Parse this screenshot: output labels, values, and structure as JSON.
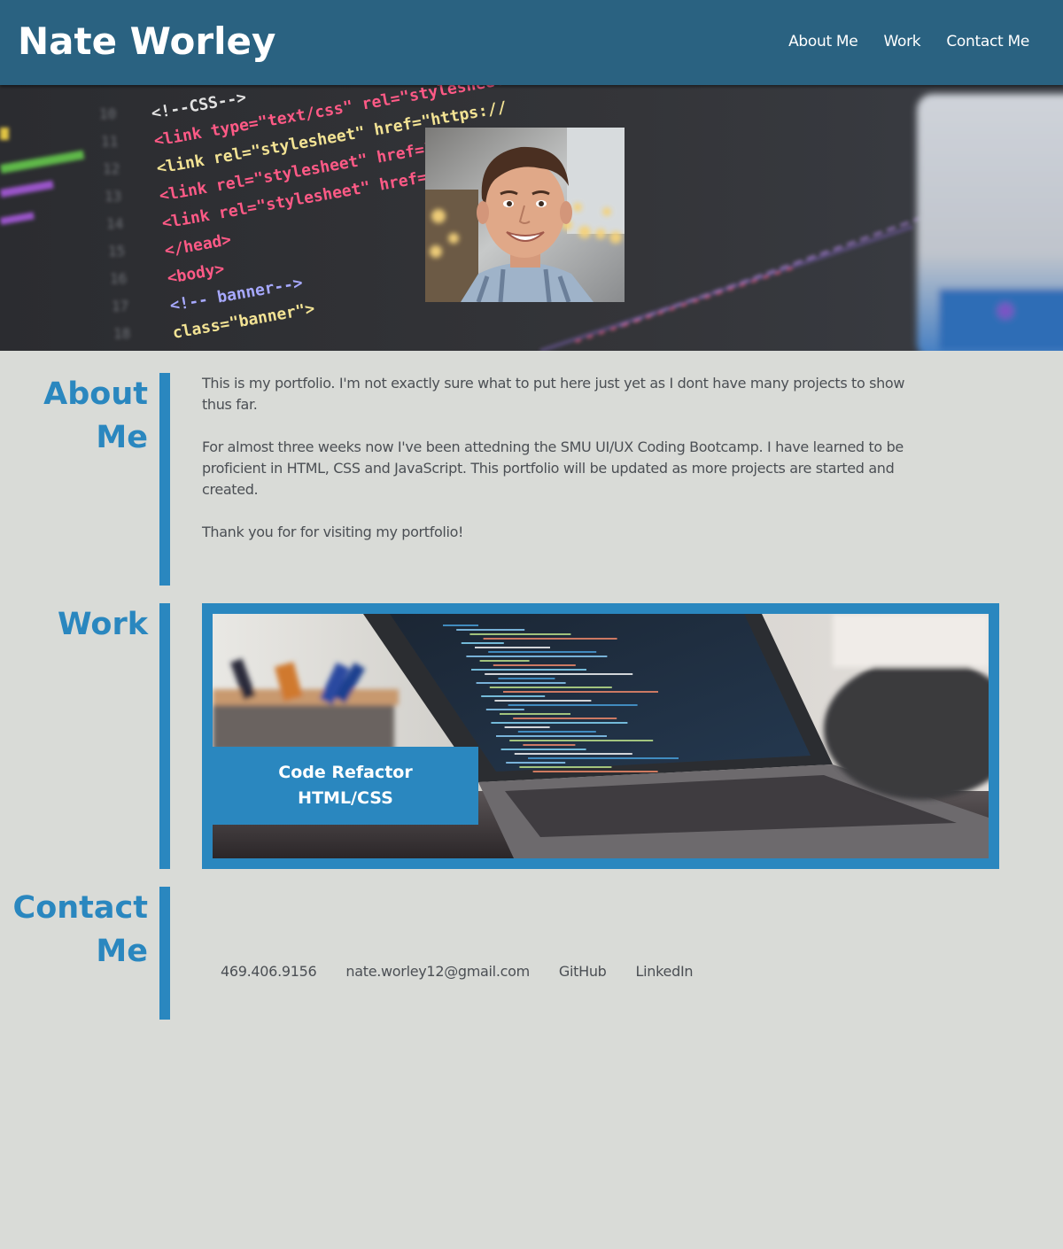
{
  "header": {
    "title": "Nate Worley",
    "nav": [
      {
        "label": "About Me"
      },
      {
        "label": "Work"
      },
      {
        "label": "Contact Me"
      }
    ]
  },
  "hero": {
    "code_lines": [
      {
        "num": "10",
        "text": "<!--CSS-->"
      },
      {
        "num": "11",
        "text": "<link type=\"text/css\" rel=\"stylesheet\" href=\"css/materialize.min.css\""
      },
      {
        "num": "12",
        "text": "<link rel=\"stylesheet\" href=\"https://"
      },
      {
        "num": "13",
        "text": "<link rel=\"stylesheet\" href=\"/css/a"
      },
      {
        "num": "14",
        "text": "<link rel=\"stylesheet\" href=\"css/th"
      },
      {
        "num": "15",
        "text": "</head>"
      },
      {
        "num": "16",
        "text": "<body>"
      },
      {
        "num": "17",
        "text": "<!-- banner-->"
      },
      {
        "num": "18",
        "text": "class=\"banner\">"
      }
    ]
  },
  "about": {
    "heading": "About Me",
    "paragraphs": [
      "This is my portfolio. I'm not exactly sure what to put here just yet as I dont have many projects to show thus far.",
      "For almost three weeks now I've been attedning the SMU UI/UX Coding Bootcamp. I have learned to be proficient in HTML, CSS and JavaScript. This portfolio will be updated as more projects are started and created.",
      "Thank you for for visiting my portfolio!"
    ]
  },
  "work": {
    "heading": "Work",
    "card": {
      "title_line1": "Code Refactor",
      "title_line2": "HTML/CSS"
    }
  },
  "contact": {
    "heading": "Contact Me",
    "items": [
      {
        "label": "469.406.9156"
      },
      {
        "label": "nate.worley12@gmail.com"
      },
      {
        "label": "GitHub"
      },
      {
        "label": "LinkedIn"
      }
    ]
  }
}
